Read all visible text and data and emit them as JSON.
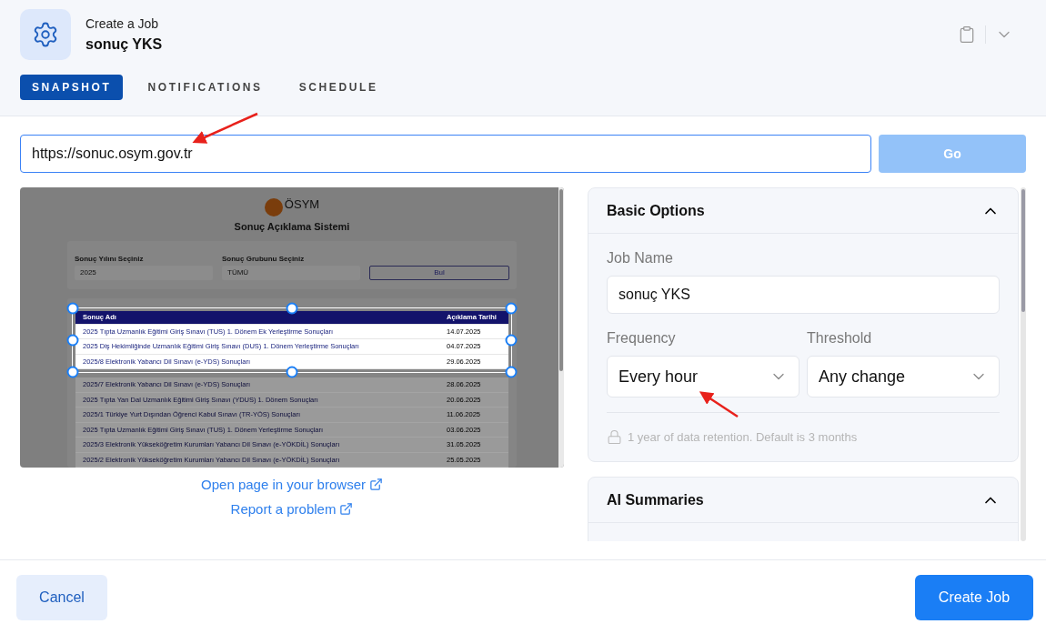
{
  "header": {
    "subtitle": "Create a Job",
    "title": "sonuç YKS"
  },
  "tabs": [
    {
      "label": "SNAPSHOT",
      "selected": true
    },
    {
      "label": "NOTIFICATIONS",
      "selected": false
    },
    {
      "label": "SCHEDULE",
      "selected": false
    }
  ],
  "url_field": {
    "value": "https://sonuc.osym.gov.tr"
  },
  "go_button": {
    "label": "Go",
    "disabled": true
  },
  "preview": {
    "logo_text": "ÖSYM",
    "heading": "Sonuç Açıklama Sistemi",
    "filters": [
      {
        "label": "Sonuç Yılını Seçiniz",
        "value": "2025"
      },
      {
        "label": "Sonuç Grubunu Seçiniz",
        "value": "TÜMÜ"
      }
    ],
    "search_button": "Bul",
    "columns": [
      "Sonuç Adı",
      "Açıklama Tarihi"
    ],
    "rows": [
      {
        "name": "2025 Tıpta Uzmanlık Eğitimi Giriş Sınavı (TUS) 1. Dönem Ek Yerleştirme Sonuçları",
        "date": "14.07.2025",
        "highlighted": true
      },
      {
        "name": "2025 Diş Hekimliğinde Uzmanlık Eğitimi Giriş Sınavı (DUS) 1. Dönem Yerleştirme Sonuçları",
        "date": "04.07.2025",
        "highlighted": true
      },
      {
        "name": "2025/8 Elektronik Yabancı Dil Sınavı (e-YDS) Sonuçları",
        "date": "29.06.2025",
        "highlighted": true
      },
      {
        "name": "2025/7 Elektronik Yabancı Dil Sınavı (e-YDS) Sonuçları",
        "date": "28.06.2025",
        "highlighted": false
      },
      {
        "name": "2025 Tıpta Yan Dal Uzmanlık Eğitimi Giriş Sınavı (YDUS) 1. Dönem Sonuçları",
        "date": "20.06.2025",
        "highlighted": false
      },
      {
        "name": "2025/1 Türkiye Yurt Dışından Öğrenci Kabul Sınavı (TR-YÖS) Sonuçları",
        "date": "11.06.2025",
        "highlighted": false
      },
      {
        "name": "2025 Tıpta Uzmanlık Eğitimi Giriş Sınavı (TUS) 1. Dönem Yerleştirme Sonuçları",
        "date": "03.06.2025",
        "highlighted": false
      },
      {
        "name": "2025/3 Elektronik Yükseköğretim Kurumları Yabancı Dil Sınavı (e-YÖKDİL) Sonuçları",
        "date": "31.05.2025",
        "highlighted": false
      },
      {
        "name": "2025/2 Elektronik Yükseköğretim Kurumları Yabancı Dil Sınavı (e-YÖKDİL) Sonuçları",
        "date": "25.05.2025",
        "highlighted": false
      }
    ]
  },
  "preview_links": [
    "Open page in your browser",
    "Report a problem"
  ],
  "basic_options": {
    "title": "Basic Options",
    "expanded": true,
    "job_name": {
      "label": "Job Name",
      "value": "sonuç YKS"
    },
    "frequency": {
      "label": "Frequency",
      "value": "Every hour"
    },
    "threshold": {
      "label": "Threshold",
      "value": "Any change"
    },
    "retention_note": "1 year of data retention. Default is 3 months"
  },
  "ai_summaries": {
    "title": "AI Summaries",
    "expanded": true
  },
  "footer": {
    "cancel": "Cancel",
    "create": "Create Job"
  }
}
